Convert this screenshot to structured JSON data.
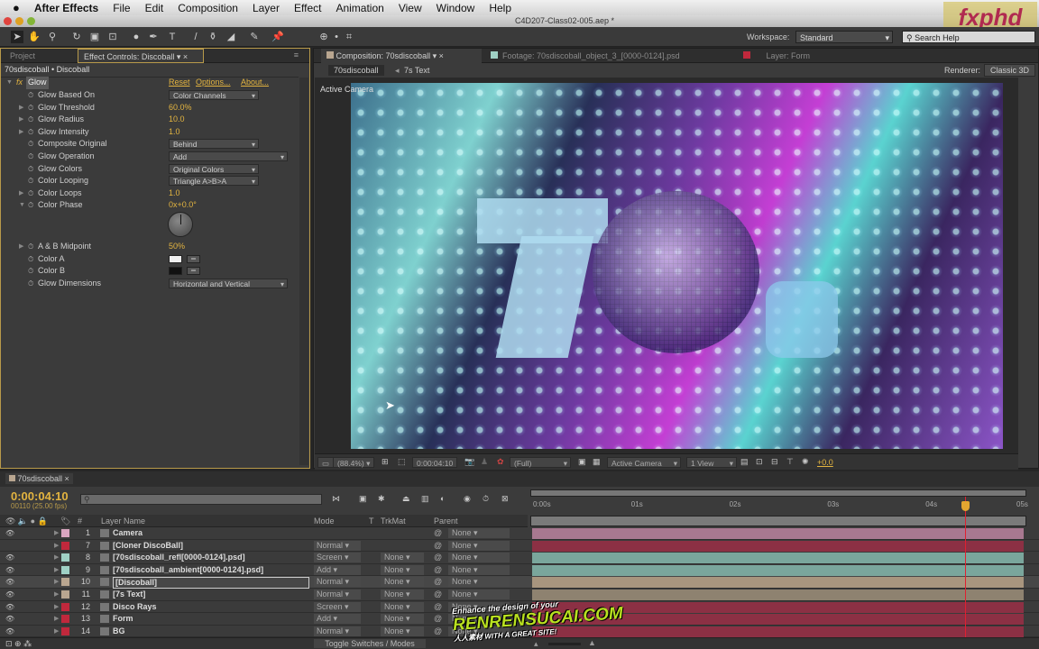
{
  "menubar": {
    "app": "After Effects",
    "items": [
      "File",
      "Edit",
      "Composition",
      "Layer",
      "Effect",
      "Animation",
      "View",
      "Window",
      "Help"
    ]
  },
  "window_title": "C4D207-Class02-005.aep *",
  "toolbar": {
    "workspace_label": "Workspace:",
    "workspace_value": "Standard",
    "search_placeholder": "Search Help"
  },
  "left_panel": {
    "tabs": [
      "Project",
      "Effect Controls: Discoball"
    ],
    "subtitle": "70sdiscoball • Discoball",
    "effect": {
      "name": "Glow",
      "reset": "Reset",
      "options": "Options...",
      "about": "About...",
      "properties": [
        {
          "name": "Glow Based On",
          "type": "dropdown",
          "value": "Color Channels"
        },
        {
          "name": "Glow Threshold",
          "type": "value",
          "value": "60.0%",
          "expand": true
        },
        {
          "name": "Glow Radius",
          "type": "value",
          "value": "10.0",
          "expand": true
        },
        {
          "name": "Glow Intensity",
          "type": "value",
          "value": "1.0",
          "expand": true
        },
        {
          "name": "Composite Original",
          "type": "dropdown",
          "value": "Behind"
        },
        {
          "name": "Glow Operation",
          "type": "dropdown",
          "value": "Add",
          "wide": true
        },
        {
          "name": "Glow Colors",
          "type": "dropdown",
          "value": "Original Colors"
        },
        {
          "name": "Color Looping",
          "type": "dropdown",
          "value": "Triangle A>B>A"
        },
        {
          "name": "Color Loops",
          "type": "value",
          "value": "1.0",
          "expand": true
        },
        {
          "name": "Color Phase",
          "type": "value",
          "value": "0x+0.0°",
          "expanded": true
        },
        {
          "name": "A & B Midpoint",
          "type": "value",
          "value": "50%",
          "expand": true
        },
        {
          "name": "Color A",
          "type": "color",
          "value": "#f0f0f0"
        },
        {
          "name": "Color B",
          "type": "color",
          "value": "#111111"
        },
        {
          "name": "Glow Dimensions",
          "type": "dropdown",
          "value": "Horizontal and Vertical",
          "wide": true
        }
      ]
    }
  },
  "comp_panel": {
    "tabs": [
      "Composition: 70sdiscoball",
      "Footage: 70sdiscoball_object_3_[0000-0124].psd",
      "Layer: Form"
    ],
    "breadcrumbs": [
      "70sdiscoball",
      "7s Text"
    ],
    "renderer_label": "Renderer:",
    "renderer_value": "Classic 3D",
    "view_label": "Active Camera",
    "footer": {
      "zoom": "(88.4%)",
      "timecode": "0:00:04:10",
      "resolution": "(Full)",
      "camera": "Active Camera",
      "views": "1 View",
      "exposure": "+0.0"
    }
  },
  "timeline": {
    "tab": "70sdiscoball",
    "current_time": "0:00:04:10",
    "frame_info": "00110 (25.00 fps)",
    "columns": {
      "name": "Layer Name",
      "mode": "Mode",
      "t": "T",
      "trkmat": "TrkMat",
      "parent": "Parent",
      "num": "#"
    },
    "ruler": [
      "0:00s",
      "01s",
      "02s",
      "03s",
      "04s",
      "05s"
    ],
    "current_time_seconds": 4.4,
    "layers": [
      {
        "num": "1",
        "name": "Camera",
        "label": "#d9a5c0",
        "bar": "#a87890",
        "mode": "",
        "trkmat": "",
        "parent": "None"
      },
      {
        "num": "7",
        "name": "[Cloner DiscoBall]",
        "label": "#c0283c",
        "bar": "#8c3044",
        "mode": "Normal",
        "trkmat": "",
        "parent": "None"
      },
      {
        "num": "8",
        "name": "[70sdiscoball_refl[0000-0124].psd]",
        "label": "#9fd0c4",
        "bar": "#7aa69c",
        "mode": "Screen",
        "trkmat": "None",
        "parent": "None"
      },
      {
        "num": "9",
        "name": "[70sdiscoball_ambient[0000-0124].psd]",
        "label": "#9fd0c4",
        "bar": "#7aa69c",
        "mode": "Add",
        "trkmat": "None",
        "parent": "None"
      },
      {
        "num": "10",
        "name": "[Discoball]",
        "label": "#b9a690",
        "bar": "#a8957e",
        "mode": "Normal",
        "trkmat": "None",
        "parent": "None",
        "selected": true
      },
      {
        "num": "11",
        "name": "[7s Text]",
        "label": "#b9a690",
        "bar": "#8e8270",
        "mode": "Normal",
        "trkmat": "None",
        "parent": "None"
      },
      {
        "num": "12",
        "name": "Disco Rays",
        "label": "#c0283c",
        "bar": "#8c3044",
        "mode": "Screen",
        "trkmat": "None",
        "parent": "None"
      },
      {
        "num": "13",
        "name": "Form",
        "label": "#c0283c",
        "bar": "#8c3044",
        "mode": "Add",
        "trkmat": "None",
        "parent": "None"
      },
      {
        "num": "14",
        "name": "BG",
        "label": "#c0283c",
        "bar": "#8c3044",
        "mode": "Normal",
        "trkmat": "None",
        "parent": "None"
      }
    ],
    "toggle_label": "Toggle Switches / Modes"
  },
  "watermarks": {
    "top": "fxphd",
    "bottom": "Enhance the design of your RENRENSUCAI.COM WITH A GREAT SITE! 人人素材"
  },
  "colors": {
    "accent": "#e3b440",
    "playhead": "#e02030"
  }
}
